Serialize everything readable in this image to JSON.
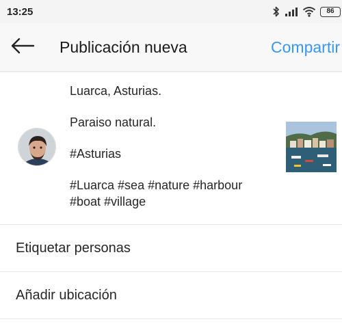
{
  "status_bar": {
    "time": "13:25",
    "battery": "86",
    "icons": [
      "bluetooth-icon",
      "signal-icon",
      "wifi-icon",
      "battery-icon"
    ]
  },
  "app_bar": {
    "back_icon": "arrow-left-icon",
    "title": "Publicación nueva",
    "share_label": "Compartir"
  },
  "post": {
    "caption_lines": [
      "Luarca, Asturias.",
      "",
      "Paraiso natural.",
      "",
      "#Asturias",
      "",
      "#Luarca #sea #nature #harbour",
      "#boat #village"
    ]
  },
  "options": [
    {
      "label": "Etiquetar personas"
    },
    {
      "label": "Añadir ubicación"
    }
  ],
  "colors": {
    "accent": "#3897f0",
    "text": "#262626",
    "divider": "#e6e6e6",
    "status_bar_bg": "#f4f4f4"
  }
}
